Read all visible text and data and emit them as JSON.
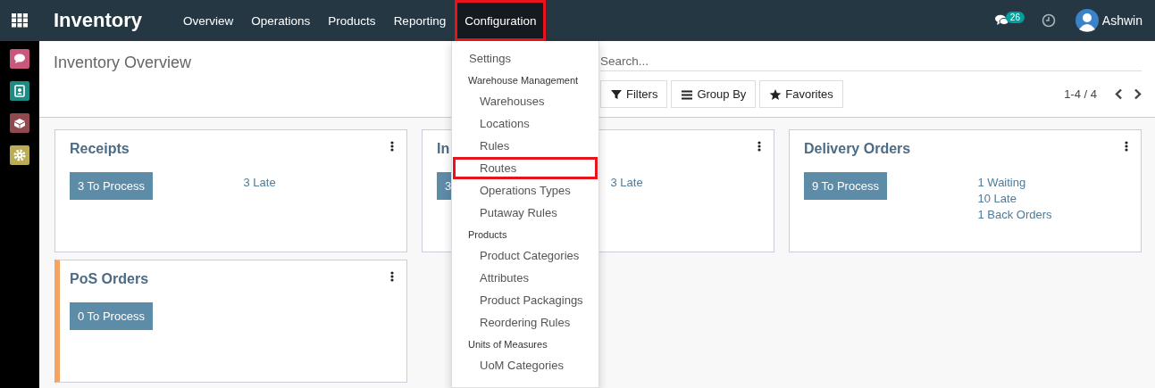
{
  "navbar": {
    "app_title": "Inventory",
    "menus": [
      {
        "label": "Overview",
        "selected": false,
        "highlighted": false
      },
      {
        "label": "Operations",
        "selected": false,
        "highlighted": false
      },
      {
        "label": "Products",
        "selected": false,
        "highlighted": false
      },
      {
        "label": "Reporting",
        "selected": false,
        "highlighted": false
      },
      {
        "label": "Configuration",
        "selected": true,
        "highlighted": true
      }
    ],
    "messages_badge": "26",
    "user_name": "Ashwin"
  },
  "control_panel": {
    "title": "Inventory Overview",
    "search": {
      "placeholder": "Search..."
    },
    "buttons": [
      {
        "kind": "filter",
        "label": "Filters"
      },
      {
        "kind": "group",
        "label": "Group By"
      },
      {
        "kind": "star",
        "label": "Favorites"
      }
    ],
    "pager": "1-4 / 4"
  },
  "kanban": {
    "cards": [
      {
        "title": "Receipts",
        "button": "3 To Process",
        "stats": [
          "3 Late"
        ]
      },
      {
        "title": "In",
        "button": "3",
        "stats": [
          "3 Late"
        ]
      },
      {
        "title": "Delivery Orders",
        "button": "9 To Process",
        "stats": [
          "1 Waiting",
          "10 Late",
          "1 Back Orders"
        ]
      },
      {
        "title": "PoS Orders",
        "button": "0 To Process",
        "color": "#f4a460"
      }
    ]
  },
  "menu": {
    "items": [
      {
        "kind": "item",
        "label": "Settings",
        "highlighted": false
      },
      {
        "kind": "header",
        "label": "Warehouse Management"
      },
      {
        "kind": "item",
        "label": "Warehouses",
        "highlighted": false
      },
      {
        "kind": "item",
        "label": "Locations",
        "highlighted": false
      },
      {
        "kind": "item",
        "label": "Rules",
        "highlighted": false
      },
      {
        "kind": "item",
        "label": "Routes",
        "highlighted": true
      },
      {
        "kind": "item",
        "label": "Operations Types",
        "highlighted": false
      },
      {
        "kind": "item",
        "label": "Putaway Rules",
        "highlighted": false
      },
      {
        "kind": "header",
        "label": "Products"
      },
      {
        "kind": "item",
        "label": "Product Categories",
        "highlighted": false
      },
      {
        "kind": "item",
        "label": "Attributes",
        "highlighted": false
      },
      {
        "kind": "item",
        "label": "Product Packagings",
        "highlighted": false
      },
      {
        "kind": "item",
        "label": "Reordering Rules",
        "highlighted": false
      },
      {
        "kind": "header",
        "label": "Units of Measures"
      },
      {
        "kind": "item",
        "label": "UoM Categories",
        "highlighted": false
      }
    ]
  }
}
